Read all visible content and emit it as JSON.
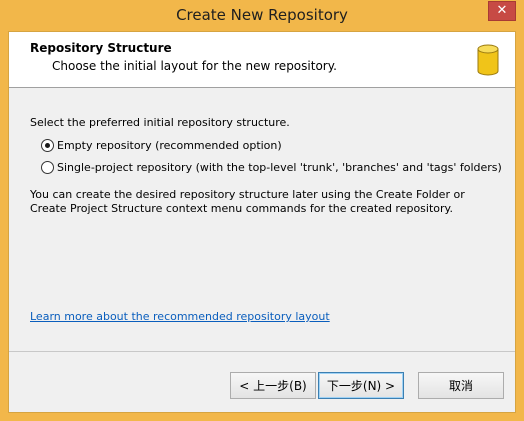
{
  "window": {
    "title": "Create New Repository",
    "close_glyph": "✕"
  },
  "header": {
    "title": "Repository Structure",
    "subtitle": "Choose the initial layout for the new repository.",
    "icon": "database-icon"
  },
  "body": {
    "prompt": "Select the preferred initial repository structure.",
    "options": [
      {
        "label": "Empty repository (recommended option)",
        "checked": true
      },
      {
        "label": "Single-project repository (with the top-level 'trunk', 'branches' and 'tags' folders)",
        "checked": false
      }
    ],
    "info": "You can create the desired repository structure later using the Create Folder or Create Project Structure context menu commands for the created repository.",
    "link": "Learn more about the recommended repository layout"
  },
  "buttons": {
    "back": "< 上一步(B)",
    "next": "下一步(N) >",
    "cancel": "取消"
  },
  "colors": {
    "titlebar": "#f2b74a",
    "close": "#c74a44",
    "link": "#0a5ebd",
    "panel": "#f0f0f0"
  }
}
